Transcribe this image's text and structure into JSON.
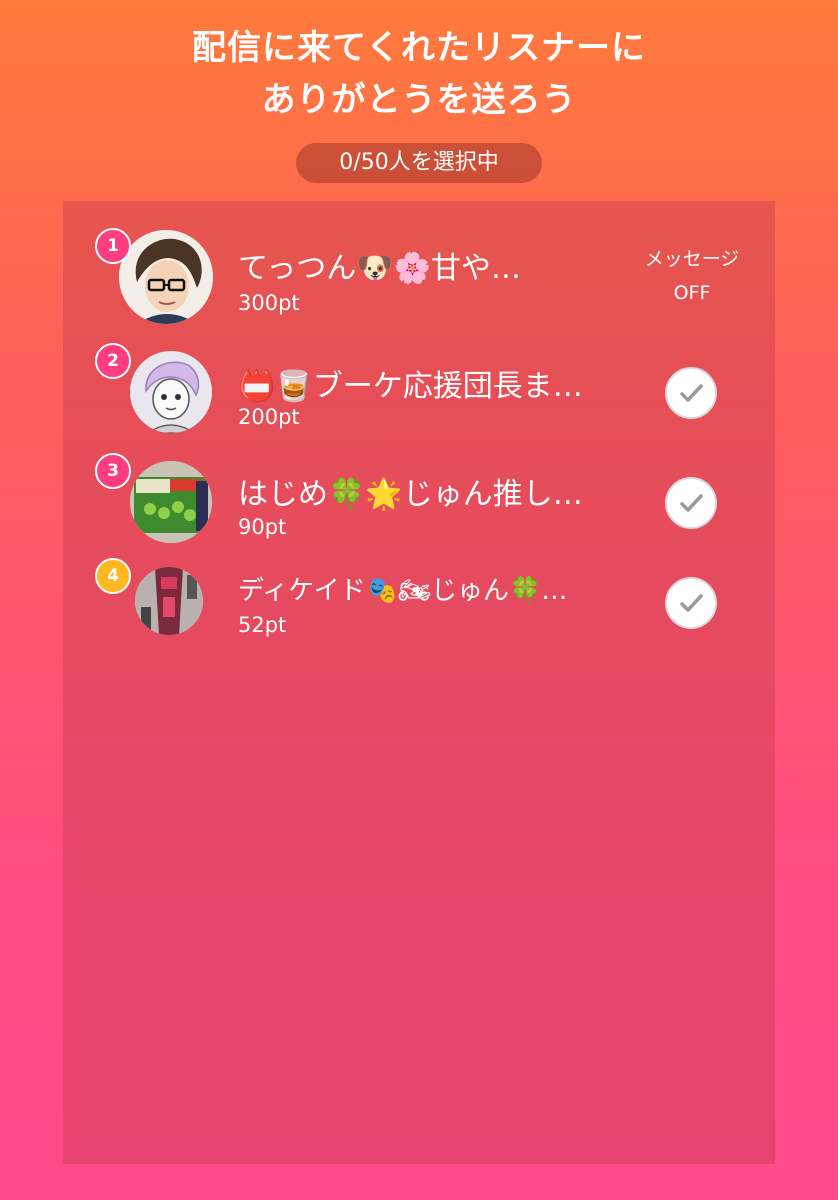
{
  "header": {
    "title_line1": "配信に来てくれたリスナーに",
    "title_line2": "ありがとうを送ろう",
    "selection_count": "0/50人を選択中"
  },
  "listeners": [
    {
      "rank": "1",
      "name": "てっつん🐶🌸甘や…",
      "points": "300pt",
      "status": "message_off",
      "message_label": "メッセージ",
      "off_label": "OFF",
      "rank_color": "#ff3d7f"
    },
    {
      "rank": "2",
      "name": "📛🥃ブーケ応援団長ま…",
      "points": "200pt",
      "status": "selectable",
      "rank_color": "#ff3d7f"
    },
    {
      "rank": "3",
      "name": "はじめ🍀🌟じゅん推し…",
      "points": "90pt",
      "status": "selectable",
      "rank_color": "#ff3d7f"
    },
    {
      "rank": "4",
      "name": "ディケイド🎭🏍じゅん🍀…",
      "points": "52pt",
      "status": "selectable",
      "rank_color": "#ffb81f"
    }
  ]
}
